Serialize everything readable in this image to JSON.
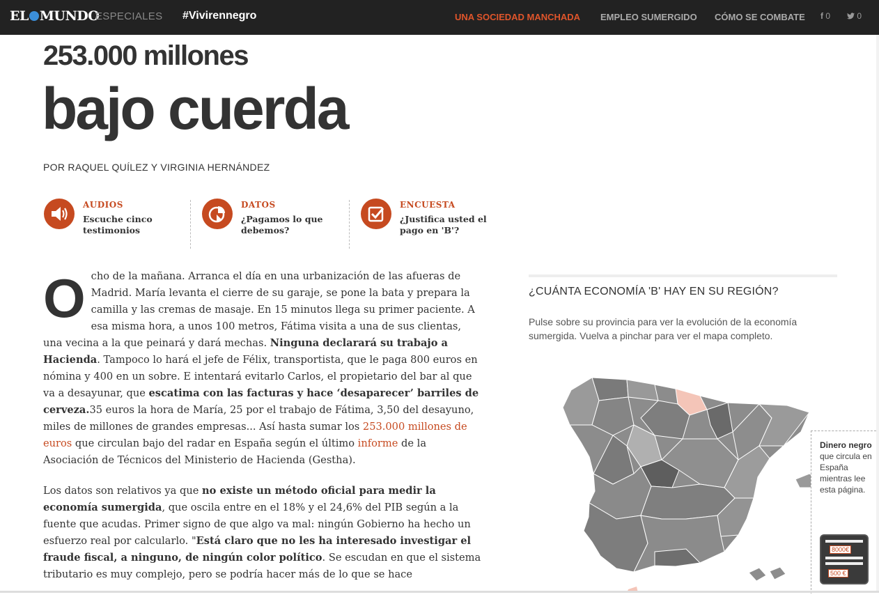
{
  "header": {
    "logo": "EL MUNDO",
    "logo_left": "EL",
    "logo_right": "MUNDO",
    "section": "ESPECIALES",
    "hashtag": "#Vivirennegro",
    "nav": [
      {
        "label": "UNA SOCIEDAD MANCHADA",
        "active": true
      },
      {
        "label": "EMPLEO SUMERGIDO",
        "active": false
      },
      {
        "label": "CÓMO SE COMBATE",
        "active": false
      }
    ],
    "facebook_count": "0",
    "twitter_count": "0"
  },
  "headline": {
    "kicker": "253.000 millones",
    "title": "bajo cuerda",
    "byline": "POR RAQUEL QUÍLEZ Y VIRGINIA HERNÁNDEZ"
  },
  "features": [
    {
      "title": "AUDIOS",
      "subtitle": "Escuche cinco testimonios",
      "icon": "speaker-icon"
    },
    {
      "title": "DATOS",
      "subtitle": "¿Pagamos lo que debemos?",
      "icon": "pie-chart-icon"
    },
    {
      "title": "ENCUESTA",
      "subtitle": "¿Justifica usted el pago en 'B'?",
      "icon": "checkbox-icon"
    }
  ],
  "article": {
    "dropcap": "O",
    "p1_a": "cho de la mañana. Arranca el día en una urbanización de las afueras de Madrid. María levanta el cierre de su garaje, se pone la bata y prepara la camilla y las cremas de masaje. En 15 minutos llega su primer paciente. A esa misma hora, a unos 100 metros, Fátima visita a una de sus clientas, una vecina a la que peinará y dará mechas. ",
    "p1_b": "Ninguna declarará su trabajo a Hacienda",
    "p1_c": ". Tampoco lo hará el jefe de Félix, transportista, que le paga 800 euros en nómina y 400 en un sobre. E intentará evitarlo Carlos, el propietario del bar al que va a desayunar, que ",
    "p1_d": "escatima con las facturas y hace ‘desaparecer’ barriles de cerveza.",
    "p1_e": "35 euros la hora de María, 25 por el trabajo de Fátima, 3,50 del desayuno, miles de millones de grandes empresas... Así hasta sumar los ",
    "p1_link1": "253.000 millones de euros",
    "p1_f": " que circulan bajo del radar en España según el último ",
    "p1_link2": "informe",
    "p1_g": " de la Asociación de Técnicos del Ministerio de Hacienda (Gestha).",
    "p2_a": "Los datos son relativos ya que ",
    "p2_b": "no existe un método oficial para medir la economía sumergida",
    "p2_c": ", que oscila entre en el 18% y el 24,6% del PIB según a la fuente que acudas. Primer signo de que algo va mal: ningún Gobierno ha hecho un esfuerzo real por calcularlo.  \"",
    "p2_d": "Está claro que no les ha interesado investigar el fraude fiscal, a ninguno, de ningún color político",
    "p2_e": ". Se escudan en que el sistema tributario es muy complejo, pero se podría hacer más de lo que se hace"
  },
  "sidebar": {
    "title": "¿CUÁNTA ECONOMÍA 'B' HAY EN SU REGIÓN?",
    "text": "Pulse sobre su provincia para ver la evolución de la economía sumergida. Vuelva a pinchar para ver el mapa completo."
  },
  "widget": {
    "bold": "Dinero negro",
    "text": " que circula en España mientras lee esta página.",
    "amount_top": "8000€",
    "amount_bottom": "500 €"
  },
  "colors": {
    "accent": "#c64a20",
    "nav_active": "#e0552b",
    "topbar": "#222222",
    "highlight_region": "#f4c5b8"
  }
}
